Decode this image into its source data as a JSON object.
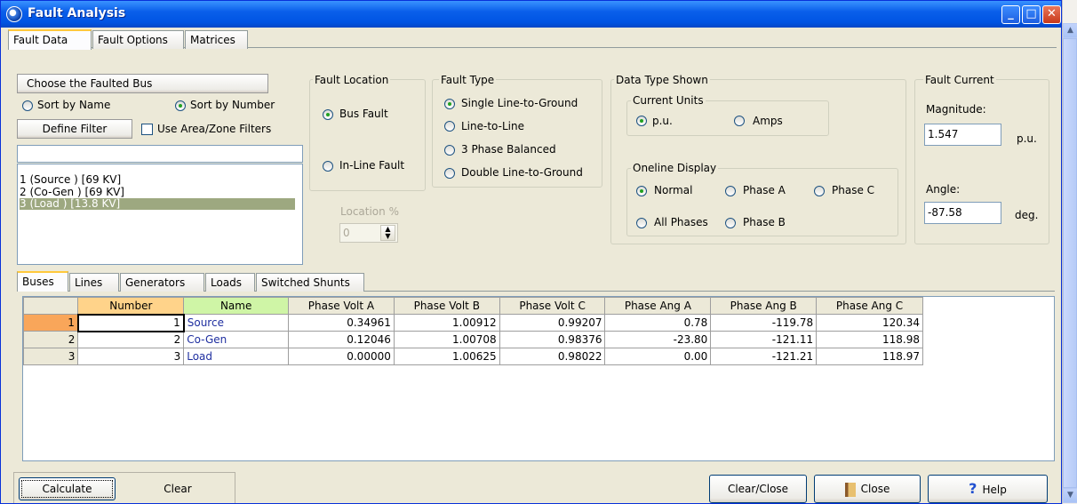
{
  "window": {
    "title": "Fault Analysis",
    "min_label": "_",
    "max_label": "□",
    "close_label": "✕"
  },
  "top_tabs": [
    "Fault Data",
    "Fault Options",
    "Matrices"
  ],
  "faulted_bus": {
    "header": "Choose the Faulted Bus",
    "sort_name": "Sort by Name",
    "sort_number": "Sort by Number",
    "define_filter": "Define Filter",
    "use_filters": "Use Area/Zone Filters",
    "filter_value": "",
    "buses": [
      "1 (Source  ) [69 KV]",
      "2 (Co-Gen  ) [69 KV]",
      "3 (Load    ) [13.8 KV]"
    ],
    "selected_index": 2
  },
  "fault_location": {
    "title": "Fault Location",
    "bus_fault": "Bus Fault",
    "inline_fault": "In-Line Fault",
    "location_label": "Location %",
    "location_value": "0"
  },
  "fault_type": {
    "title": "Fault Type",
    "options": [
      "Single Line-to-Ground",
      "Line-to-Line",
      "3 Phase Balanced",
      "Double Line-to-Ground"
    ],
    "selected": 0
  },
  "data_type": {
    "title": "Data Type Shown",
    "current_units": "Current Units",
    "pu": "p.u.",
    "amps": "Amps",
    "oneline": "Oneline Display",
    "normal": "Normal",
    "phase_a": "Phase A",
    "phase_c": "Phase C",
    "all_phases": "All Phases",
    "phase_b": "Phase B"
  },
  "fault_current": {
    "title": "Fault Current",
    "magnitude_label": "Magnitude:",
    "magnitude": "1.547",
    "magnitude_unit": "p.u.",
    "angle_label": "Angle:",
    "angle": "-87.58",
    "angle_unit": "deg."
  },
  "bottom_tabs": [
    "Buses",
    "Lines",
    "Generators",
    "Loads",
    "Switched Shunts"
  ],
  "table": {
    "headers": [
      "",
      "Number",
      "Name",
      "Phase Volt A",
      "Phase Volt B",
      "Phase Volt C",
      "Phase Ang A",
      "Phase Ang B",
      "Phase Ang C"
    ],
    "rows": [
      [
        "1",
        "1",
        "Source",
        "0.34961",
        "1.00912",
        "0.99207",
        "0.78",
        "-119.78",
        "120.34"
      ],
      [
        "2",
        "2",
        "Co-Gen",
        "0.12046",
        "1.00708",
        "0.98376",
        "-23.80",
        "-121.11",
        "118.98"
      ],
      [
        "3",
        "3",
        "Load",
        "0.00000",
        "1.00625",
        "0.98022",
        "0.00",
        "-121.21",
        "118.97"
      ]
    ]
  },
  "buttons": {
    "calculate": "Calculate",
    "clear": "Clear",
    "clear_close": "Clear/Close",
    "close": "Close",
    "help": "Help"
  },
  "colors": {
    "title_bar": "#0054E3",
    "selected_list_item": "#9DA880",
    "number_header": "#FFD38A",
    "name_header": "#CFF5A6",
    "name_text": "#1F2FA0",
    "row_header_active": "#F9A65A"
  }
}
